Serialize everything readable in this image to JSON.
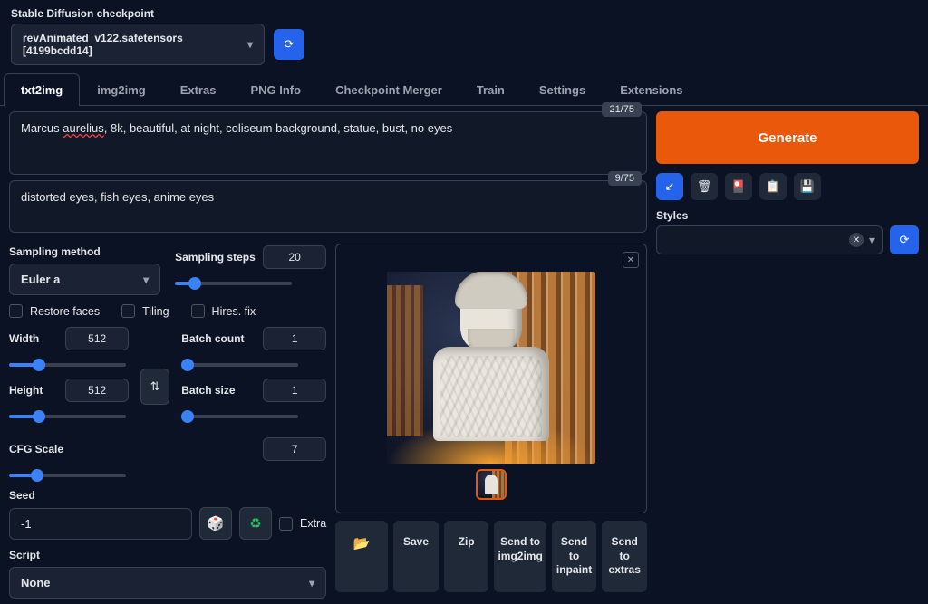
{
  "checkpoint": {
    "label": "Stable Diffusion checkpoint",
    "value": "revAnimated_v122.safetensors [4199bcdd14]"
  },
  "tabs": [
    "txt2img",
    "img2img",
    "Extras",
    "PNG Info",
    "Checkpoint Merger",
    "Train",
    "Settings",
    "Extensions"
  ],
  "prompt": {
    "text_before": "Marcus ",
    "text_underlined": "aurelius",
    "text_after": ", 8k, beautiful, at night,  coliseum background, statue, bust, no eyes",
    "count": "21/75"
  },
  "neg_prompt": {
    "text": "distorted eyes, fish eyes, anime eyes",
    "count": "9/75"
  },
  "generate": "Generate",
  "styles_label": "Styles",
  "sampling": {
    "method_label": "Sampling method",
    "method_value": "Euler a",
    "steps_label": "Sampling steps",
    "steps_value": "20"
  },
  "checks": {
    "restore": "Restore faces",
    "tiling": "Tiling",
    "hires": "Hires. fix"
  },
  "dims": {
    "width_label": "Width",
    "width_value": "512",
    "height_label": "Height",
    "height_value": "512",
    "batch_count_label": "Batch count",
    "batch_count_value": "1",
    "batch_size_label": "Batch size",
    "batch_size_value": "1"
  },
  "cfg": {
    "label": "CFG Scale",
    "value": "7"
  },
  "seed": {
    "label": "Seed",
    "value": "-1",
    "extra": "Extra"
  },
  "script": {
    "label": "Script",
    "value": "None"
  },
  "actions": {
    "save": "Save",
    "zip": "Zip",
    "img2img": "Send to img2img",
    "inpaint": "Send to inpaint",
    "extras": "Send to extras"
  }
}
